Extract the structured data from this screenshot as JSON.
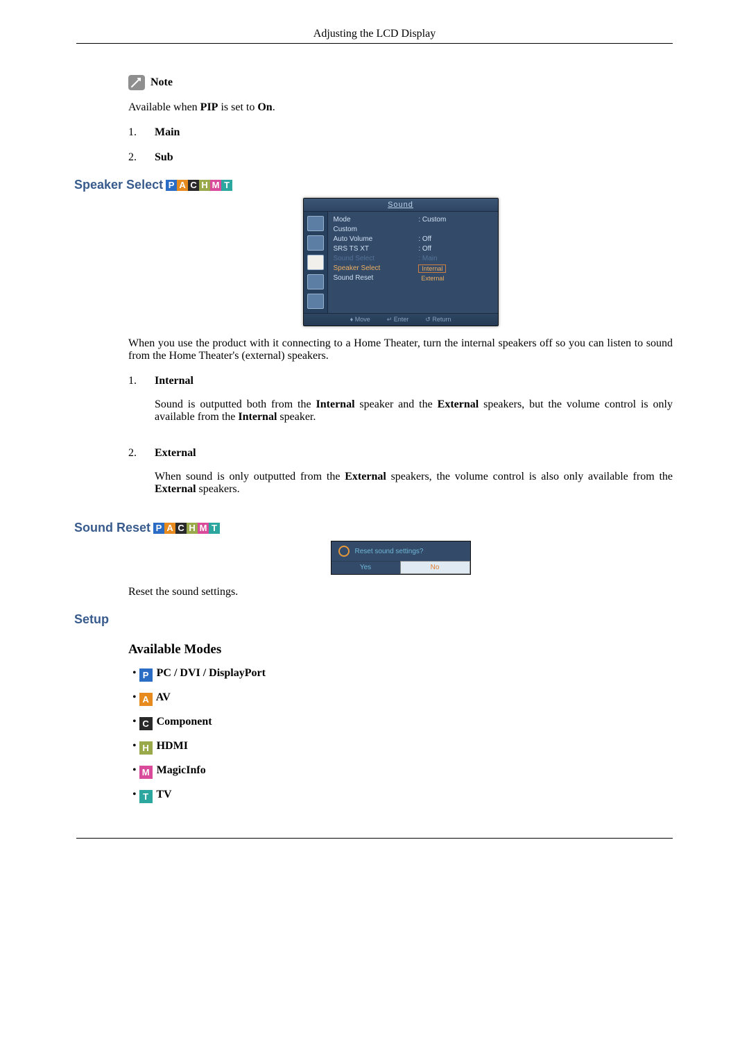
{
  "header": {
    "title": "Adjusting the LCD Display"
  },
  "note": {
    "label": "Note",
    "text_prefix": "Available when ",
    "pip": "PIP",
    "text_mid": " is set to ",
    "on": "On",
    "text_suffix": "."
  },
  "main_sub": {
    "items": [
      {
        "num": "1.",
        "label": "Main"
      },
      {
        "num": "2.",
        "label": "Sub"
      }
    ]
  },
  "section_speaker": {
    "title": "Speaker Select",
    "osd": {
      "title": "Sound",
      "rows": {
        "mode": "Mode",
        "mode_val": ": Custom",
        "custom": "Custom",
        "auto_volume": "Auto Volume",
        "auto_volume_val": ": Off",
        "srs": "SRS TS XT",
        "srs_val": ": Off",
        "sound_select": "Sound Select",
        "sound_select_val": ": Main",
        "speaker_select": "Speaker Select",
        "opt_internal": "Internal",
        "opt_external": "External",
        "sound_reset": "Sound Reset"
      },
      "footer": {
        "move": "Move",
        "enter": "Enter",
        "return": "Return"
      }
    },
    "para": "When you use the product with it connecting to a Home Theater, turn the internal speakers off so you can listen to sound from the Home Theater's (external) speakers.",
    "items": [
      {
        "num": "1.",
        "label": "Internal",
        "desc_pre": "Sound is outputted both from the ",
        "b1": "Internal",
        "desc_mid1": " speaker and the ",
        "b2": "External",
        "desc_mid2": " speakers, but the volume control is only available from the ",
        "b3": "Internal",
        "desc_suf": " speaker."
      },
      {
        "num": "2.",
        "label": "External",
        "desc_pre": "When sound is only outputted from the ",
        "b1": "External",
        "desc_mid1": " speakers, the volume control is also only available from the ",
        "b2": "External",
        "desc_suf": " speakers."
      }
    ]
  },
  "section_reset": {
    "title": "Sound Reset",
    "dialog": {
      "question": "Reset sound settings?",
      "yes": "Yes",
      "no": "No"
    },
    "para": "Reset the sound settings."
  },
  "section_setup": {
    "title": "Setup",
    "subtitle": "Available Modes",
    "modes": [
      {
        "chip": "P",
        "chip_cls": "chip-p",
        "label": " PC / DVI / DisplayPort"
      },
      {
        "chip": "A",
        "chip_cls": "chip-a",
        "label": " AV"
      },
      {
        "chip": "C",
        "chip_cls": "chip-c",
        "label": " Component"
      },
      {
        "chip": "H",
        "chip_cls": "chip-h",
        "label": " HDMI"
      },
      {
        "chip": "M",
        "chip_cls": "chip-m",
        "label": " MagicInfo"
      },
      {
        "chip": "T",
        "chip_cls": "chip-t",
        "label": " TV"
      }
    ]
  },
  "pachmt": {
    "p": "P",
    "a": "A",
    "c": "C",
    "h": "H",
    "m": "M",
    "t": "T"
  }
}
